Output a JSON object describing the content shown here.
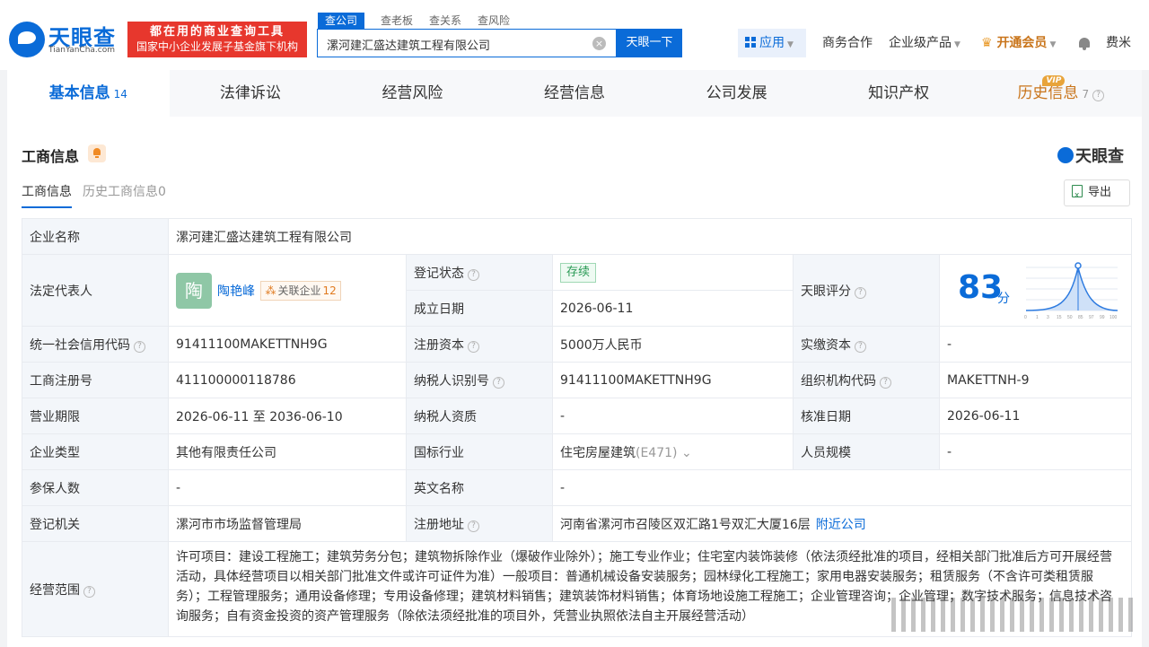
{
  "header": {
    "logo_text": "天眼查",
    "logo_sub": "TianYanCha.com",
    "slogan_line1": "都在用的商业查询工具",
    "slogan_line2": "国家中小企业发展子基金旗下机构",
    "search_tabs": [
      "查公司",
      "查老板",
      "查关系",
      "查风险"
    ],
    "search_value": "漯河建汇盛达建筑工程有限公司",
    "search_button": "天眼一下",
    "nav": {
      "apps": "应用",
      "business": "商务合作",
      "enterprise": "企业级产品",
      "vip": "开通会员",
      "user": "费米"
    }
  },
  "main_tabs": [
    {
      "label": "基本信息",
      "count": "14"
    },
    {
      "label": "法律诉讼"
    },
    {
      "label": "经营风险"
    },
    {
      "label": "经营信息"
    },
    {
      "label": "公司发展"
    },
    {
      "label": "知识产权"
    },
    {
      "label": "历史信息",
      "count": "7",
      "badge": "VIP"
    }
  ],
  "section": {
    "title": "工商信息",
    "brand": "天眼查",
    "sub_tabs": [
      "工商信息",
      "历史工商信息0"
    ],
    "export": "导出"
  },
  "info": {
    "company_name_label": "企业名称",
    "company_name": "漯河建汇盛达建筑工程有限公司",
    "legal_rep_label": "法定代表人",
    "avatar_char": "陶",
    "legal_rep": "陶艳峰",
    "assoc_label": "关联企业",
    "assoc_count": "12",
    "reg_status_label": "登记状态",
    "reg_status": "存续",
    "found_date_label": "成立日期",
    "found_date": "2026-06-11",
    "score_label": "天眼评分",
    "score": "83",
    "score_unit": "分",
    "score_ticks": [
      "0",
      "1",
      "3",
      "15",
      "50",
      "85",
      "97",
      "99",
      "100"
    ],
    "credit_code_label": "统一社会信用代码",
    "credit_code": "91411100MAKETTNH9G",
    "reg_capital_label": "注册资本",
    "reg_capital": "5000万人民币",
    "paid_capital_label": "实缴资本",
    "paid_capital": "-",
    "biz_reg_no_label": "工商注册号",
    "biz_reg_no": "411100000118786",
    "taxpayer_id_label": "纳税人识别号",
    "taxpayer_id": "91411100MAKETTNH9G",
    "org_code_label": "组织机构代码",
    "org_code": "MAKETTNH-9",
    "term_label": "营业期限",
    "term": "2026-06-11 至 2036-06-10",
    "taxpayer_qual_label": "纳税人资质",
    "taxpayer_qual": "-",
    "approve_date_label": "核准日期",
    "approve_date": "2026-06-11",
    "company_type_label": "企业类型",
    "company_type": "其他有限责任公司",
    "industry_label": "国标行业",
    "industry": "住宅房屋建筑",
    "industry_code": "(E471)",
    "staff_size_label": "人员规模",
    "staff_size": "-",
    "insured_label": "参保人数",
    "insured": "-",
    "english_name_label": "英文名称",
    "english_name": "-",
    "reg_authority_label": "登记机关",
    "reg_authority": "漯河市市场监督管理局",
    "reg_address_label": "注册地址",
    "reg_address": "河南省漯河市召陵区双汇路1号双汇大厦16层",
    "nearby_link": "附近公司",
    "scope_label": "经营范围",
    "scope": "许可项目：建设工程施工；建筑劳务分包；建筑物拆除作业（爆破作业除外）；施工专业作业；住宅室内装饰装修（依法须经批准的项目，经相关部门批准后方可开展经营活动，具体经营项目以相关部门批准文件或许可证件为准）一般项目：普通机械设备安装服务；园林绿化工程施工；家用电器安装服务；租赁服务（不含许可类租赁服务）；工程管理服务；通用设备修理；专用设备修理；建筑材料销售；建筑装饰材料销售；体育场地设施工程施工；企业管理咨询；企业管理；数字技术服务；信息技术咨询服务；自有资金投资的资产管理服务（除依法须经批准的项目外，凭营业执照依法自主开展经营活动）"
  }
}
